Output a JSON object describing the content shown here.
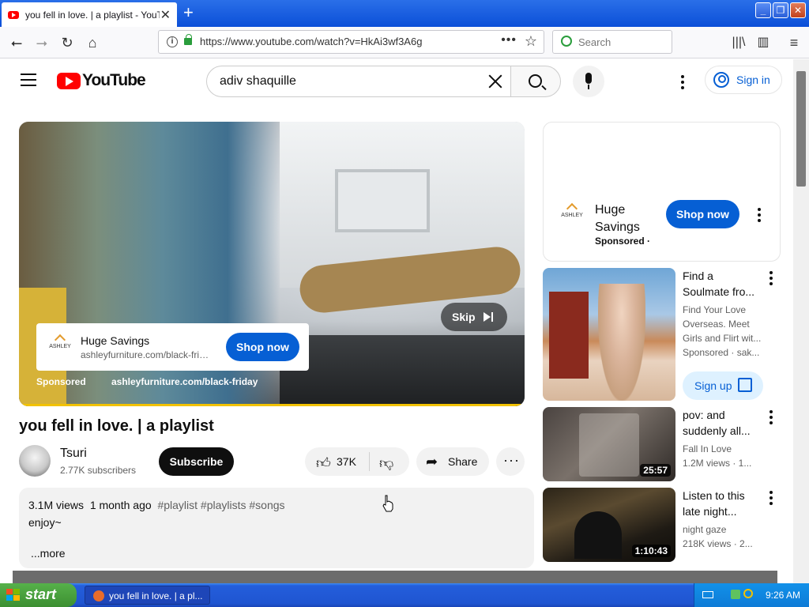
{
  "browser": {
    "tab_title": "you fell in love. | a playlist - YouTube",
    "new_tab": "+",
    "url": "https://www.youtube.com/watch?v=HkAi3wf3A6g",
    "search_placeholder": "Search"
  },
  "yt_header": {
    "logo_text": "YouTube",
    "search_query": "adiv shaquille",
    "signin_label": "Sign in"
  },
  "player": {
    "ad_title": "Huge Savings",
    "ad_domain": "ashleyfurniture.com/black-friday",
    "ad_cta": "Shop now",
    "skip_label": "Skip",
    "sponsored_label": "Sponsored",
    "ad_url": "ashleyfurniture.com/black-friday",
    "advertiser_logo_text": "ASHLEY",
    "progress_fraction": 1.0
  },
  "video": {
    "title": "you fell in love. | a playlist",
    "channel_name": "Tsuri",
    "subscribers": "2.77K subscribers",
    "subscribe_label": "Subscribe",
    "likes": "37K",
    "share_label": "Share",
    "views": "3.1M views",
    "age": "1 month ago",
    "hashtags": "#playlist #playlists #songs",
    "description": "enjoy~",
    "more_label": "...more"
  },
  "sidebar_ad": {
    "logo_text": "ASHLEY",
    "title": "Huge Savings",
    "sponsored": "Sponsored · ",
    "cta": "Shop now"
  },
  "recommendations": [
    {
      "title": "Find a Soulmate fro...",
      "line1": "Find Your Love Overseas. Meet Girls and Flirt wit...",
      "line2": "Sponsored · sak...",
      "cta": "Sign up"
    },
    {
      "title": "pov: and suddenly all...",
      "channel": "Fall In Love",
      "stats": "1.2M views · 1...",
      "duration": "25:57"
    },
    {
      "title": "Listen to this late night...",
      "channel": "night gaze",
      "stats": "218K views · 2...",
      "duration": "1:10:43"
    }
  ],
  "taskbar": {
    "start_label": "start",
    "task_label": "you fell in love. | a pl...",
    "clock": "9:26 AM"
  },
  "colors": {
    "brand_red": "#ff0000",
    "link_blue": "#065fd4",
    "xp_blue": "#245edb",
    "xp_green": "#3c8f31"
  }
}
